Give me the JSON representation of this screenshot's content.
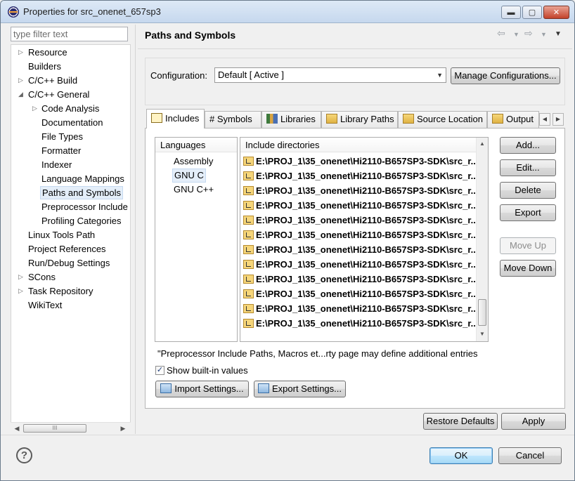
{
  "window": {
    "title": "Properties for src_onenet_657sp3",
    "min_glyph": "▬",
    "max_glyph": "▢",
    "close_glyph": "✕"
  },
  "filter": {
    "placeholder": "type filter text",
    "value": ""
  },
  "tree": {
    "items": [
      {
        "label": "Resource"
      },
      {
        "label": "Builders"
      },
      {
        "label": "C/C++ Build"
      },
      {
        "label": "C/C++ General"
      },
      {
        "label": "Code Analysis"
      },
      {
        "label": "Documentation"
      },
      {
        "label": "File Types"
      },
      {
        "label": "Formatter"
      },
      {
        "label": "Indexer"
      },
      {
        "label": "Language Mappings"
      },
      {
        "label": "Paths and Symbols"
      },
      {
        "label": "Preprocessor Include"
      },
      {
        "label": "Profiling Categories"
      },
      {
        "label": "Linux Tools Path"
      },
      {
        "label": "Project References"
      },
      {
        "label": "Run/Debug Settings"
      },
      {
        "label": "SCons"
      },
      {
        "label": "Task Repository"
      },
      {
        "label": "WikiText"
      }
    ],
    "selected": "Paths and Symbols",
    "scroll_thumb_glyph": "III"
  },
  "page": {
    "title": "Paths and Symbols"
  },
  "config": {
    "label": "Configuration:",
    "selected": "Default  [ Active ]",
    "manage_label": "Manage Configurations..."
  },
  "tabs": [
    {
      "label": "Includes",
      "icon": "includes-icon"
    },
    {
      "label": "# Symbols",
      "icon": "symbols-icon"
    },
    {
      "label": "Libraries",
      "icon": "libraries-icon"
    },
    {
      "label": "Library Paths",
      "icon": "library-paths-icon"
    },
    {
      "label": "Source Location",
      "icon": "source-location-icon"
    },
    {
      "label": "Output",
      "icon": "output-icon"
    }
  ],
  "languages": {
    "header": "Languages",
    "items": [
      "Assembly",
      "GNU C",
      "GNU C++"
    ],
    "selected": "GNU C"
  },
  "includes": {
    "header": "Include directories",
    "rows": [
      "E:\\PROJ_1\\35_onenet\\Hi2110-B657SP3-SDK\\src_r...",
      "E:\\PROJ_1\\35_onenet\\Hi2110-B657SP3-SDK\\src_r...",
      "E:\\PROJ_1\\35_onenet\\Hi2110-B657SP3-SDK\\src_r...",
      "E:\\PROJ_1\\35_onenet\\Hi2110-B657SP3-SDK\\src_r...",
      "E:\\PROJ_1\\35_onenet\\Hi2110-B657SP3-SDK\\src_r...",
      "E:\\PROJ_1\\35_onenet\\Hi2110-B657SP3-SDK\\src_r...",
      "E:\\PROJ_1\\35_onenet\\Hi2110-B657SP3-SDK\\src_r...",
      "E:\\PROJ_1\\35_onenet\\Hi2110-B657SP3-SDK\\src_r...",
      "E:\\PROJ_1\\35_onenet\\Hi2110-B657SP3-SDK\\src_r...",
      "E:\\PROJ_1\\35_onenet\\Hi2110-B657SP3-SDK\\src_r...",
      "E:\\PROJ_1\\35_onenet\\Hi2110-B657SP3-SDK\\src_r...",
      "E:\\PROJ_1\\35_onenet\\Hi2110-B657SP3-SDK\\src_r..."
    ]
  },
  "side_buttons": {
    "add": "Add...",
    "edit": "Edit...",
    "delete": "Delete",
    "export": "Export",
    "move_up": "Move Up",
    "move_down": "Move Down"
  },
  "note": "\"Preprocessor Include Paths, Macros et...rty page may define additional entries",
  "show_builtin": {
    "label": "Show built-in values",
    "checked": true,
    "glyph": "✓"
  },
  "import_label": "Import Settings...",
  "export_settings_label": "Export Settings...",
  "restore_label": "Restore Defaults",
  "apply_label": "Apply",
  "ok_label": "OK",
  "cancel_label": "Cancel",
  "help_glyph": "?",
  "colors": {
    "selection": "#e4eef9",
    "default_button_border": "#3c7fb1"
  }
}
